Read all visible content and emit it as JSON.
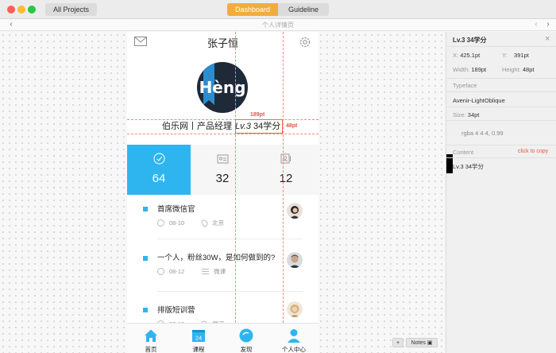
{
  "window": {
    "all_projects": "All Projects",
    "tabs": [
      {
        "label": "Dashboard",
        "active": true
      },
      {
        "label": "Guideline",
        "active": false
      }
    ]
  },
  "nav": {
    "breadcrumb": "个人详情页"
  },
  "phone": {
    "header": {
      "name": "张子恒"
    },
    "avatar": {
      "logo_text": "Hèng"
    },
    "subtitle": "伯乐网丨产品经理",
    "level": {
      "prefix": "Lv.3",
      "points": "34学分"
    },
    "stats": [
      {
        "icon": "check-circle-icon",
        "value": "64",
        "active": true
      },
      {
        "icon": "id-card-icon",
        "value": "32",
        "active": false
      },
      {
        "icon": "contacts-icon",
        "value": "12",
        "active": false
      }
    ],
    "list": [
      {
        "title": "首席微信官",
        "date": "08-10",
        "meta_icon": "location-pin-icon",
        "meta": "北京",
        "avatar": "female-avatar"
      },
      {
        "title": "一个人，粉丝30W，是如何做到的?",
        "date": "08-12",
        "meta_icon": "list-icon",
        "meta": "微课",
        "avatar": "male-avatar"
      },
      {
        "title": "排版短训营",
        "date": "08-13",
        "meta_icon": "location-pin-icon",
        "meta": "武汉",
        "avatar": "blonde-avatar"
      }
    ],
    "tabbar": [
      {
        "label": "首页",
        "icon": "home-icon"
      },
      {
        "label": "课程",
        "icon": "calendar-icon",
        "badge": "24"
      },
      {
        "label": "发现",
        "icon": "discover-icon"
      },
      {
        "label": "个人中心",
        "icon": "user-icon"
      }
    ]
  },
  "measure": {
    "width_label": "189pt",
    "height_label": "48pt"
  },
  "inspector": {
    "title": "Lv.3  34学分",
    "x_label": "X:",
    "x": "425.1pt",
    "y_label": "Y:",
    "y": "391pt",
    "width_label": "Width:",
    "width": "189pt",
    "height_label": "Height:",
    "height": "48pt",
    "typeface_label": "Typeface",
    "typeface": "Avenir-LightOblique",
    "size_label": "Size:",
    "size": "34pt",
    "color": "rgba 4 4 4, 0.99",
    "content_label": "Content",
    "copy_label": "click to copy",
    "content": "Lv.3  34学分"
  },
  "footer": {
    "notes": "Notes"
  },
  "colors": {
    "accent": "#2eb5ef",
    "highlight": "#f2ac3c",
    "measure": "#e8553e"
  }
}
